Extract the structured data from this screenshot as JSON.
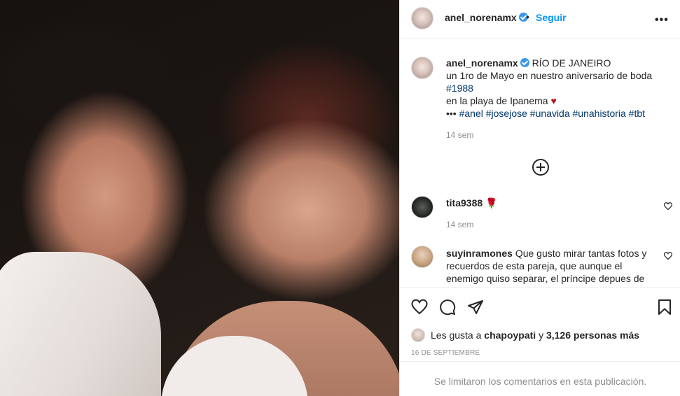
{
  "post": {
    "username": "anel_norenamx",
    "follow_label": "Seguir",
    "dot": "•",
    "more": "•••"
  },
  "caption": {
    "username": "anel_norenamx",
    "location": "RÍO DE JANEIRO",
    "line1": "un 1ro de Mayo en nuestro aniversario de boda",
    "tag_year": "#1988",
    "line3": "en la playa de Ipanema",
    "heart": "♥",
    "dots": "•••",
    "tags": "#anel #josejose #unavida #unahistoria #tbt",
    "time": "14 sem"
  },
  "comments": [
    {
      "username": "tita9388",
      "text": "🌹",
      "time": "14 sem"
    },
    {
      "username": "suyinramones",
      "text": "Que gusto mirar tantas fotos y recuerdos de esta pareja, que aunque el enemigo quiso separar, el príncipe depues de"
    }
  ],
  "likes": {
    "prefix": "Les gusta a",
    "user": "chapoypati",
    "middle": "y",
    "count_text": "3,126 personas más"
  },
  "date": "16 DE SEPTIEMBRE",
  "comments_limited": "Se limitaron los comentarios en esta publicación.",
  "colors": {
    "accent": "#0095f6",
    "verified": "#3897f0",
    "heart": "#b01c1c"
  }
}
